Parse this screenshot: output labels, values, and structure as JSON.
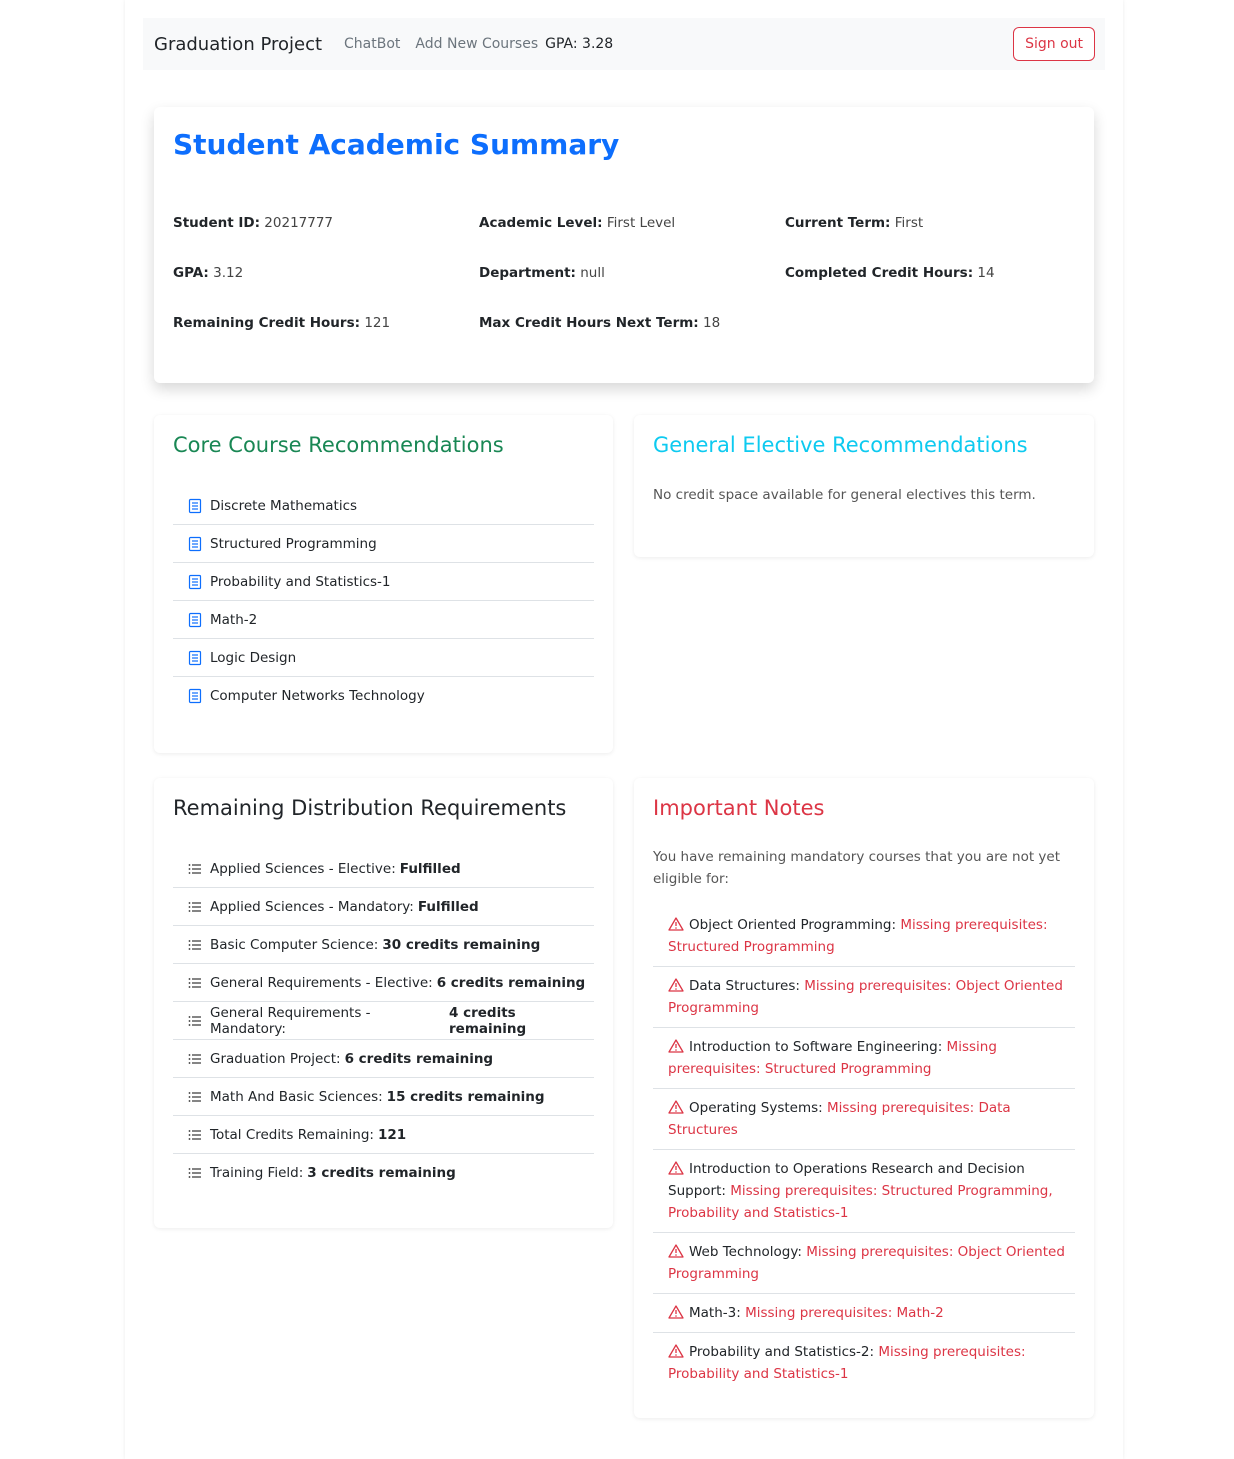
{
  "navbar": {
    "brand": "Graduation Project",
    "links": [
      "ChatBot",
      "Add New Courses"
    ],
    "gpa_text": "GPA: 3.28",
    "signout_label": "Sign out"
  },
  "summary": {
    "title": "Student Academic Summary",
    "fields": [
      {
        "label": "Student ID:",
        "value": "20217777"
      },
      {
        "label": "Academic Level:",
        "value": "First Level"
      },
      {
        "label": "Current Term:",
        "value": "First"
      },
      {
        "label": "GPA:",
        "value": "3.12"
      },
      {
        "label": "Department:",
        "value": "null"
      },
      {
        "label": "Completed Credit Hours:",
        "value": "14"
      },
      {
        "label": "Remaining Credit Hours:",
        "value": "121"
      },
      {
        "label": "Max Credit Hours Next Term:",
        "value": "18"
      }
    ]
  },
  "core": {
    "title": "Core Course Recommendations",
    "icon": "book-icon",
    "courses": [
      "Discrete Mathematics",
      "Structured Programming",
      "Probability and Statistics-1",
      "Math-2",
      "Logic Design",
      "Computer Networks Technology"
    ]
  },
  "elective": {
    "title": "General Elective Recommendations",
    "message": "No credit space available for general electives this term."
  },
  "distribution": {
    "title": "Remaining Distribution Requirements",
    "icon": "list-icon",
    "items": [
      {
        "label": "Applied Sciences - Elective:",
        "status": "Fulfilled"
      },
      {
        "label": "Applied Sciences - Mandatory:",
        "status": "Fulfilled"
      },
      {
        "label": "Basic Computer Science:",
        "status": "30 credits remaining"
      },
      {
        "label": "General Requirements - Elective:",
        "status": "6 credits remaining"
      },
      {
        "label": "General Requirements - Mandatory:",
        "status": "4 credits remaining"
      },
      {
        "label": "Graduation Project:",
        "status": "6 credits remaining"
      },
      {
        "label": "Math And Basic Sciences:",
        "status": "15 credits remaining"
      },
      {
        "label": "Total Credits Remaining:",
        "status": "121"
      },
      {
        "label": "Training Field:",
        "status": "3 credits remaining"
      }
    ]
  },
  "notes": {
    "title": "Important Notes",
    "intro": "You have remaining mandatory courses that you are not yet eligible for:",
    "icon": "warning-icon",
    "items": [
      {
        "course": "Object Oriented Programming:",
        "reason": "Missing prerequisites: Structured Programming"
      },
      {
        "course": "Data Structures:",
        "reason": "Missing prerequisites: Object Oriented Programming"
      },
      {
        "course": "Introduction to Software Engineering:",
        "reason": "Missing prerequisites: Structured Programming"
      },
      {
        "course": "Operating Systems:",
        "reason": "Missing prerequisites: Data Structures"
      },
      {
        "course": "Introduction to Operations Research and Decision Support:",
        "reason": "Missing prerequisites: Structured Programming, Probability and Statistics-1"
      },
      {
        "course": "Web Technology:",
        "reason": "Missing prerequisites: Object Oriented Programming"
      },
      {
        "course": "Math-3:",
        "reason": "Missing prerequisites: Math-2"
      },
      {
        "course": "Probability and Statistics-2:",
        "reason": "Missing prerequisites: Probability and Statistics-1"
      }
    ]
  },
  "colors": {
    "primary": "#0d6efd",
    "success": "#198754",
    "info": "#0dcaf0",
    "danger": "#dc3545"
  }
}
